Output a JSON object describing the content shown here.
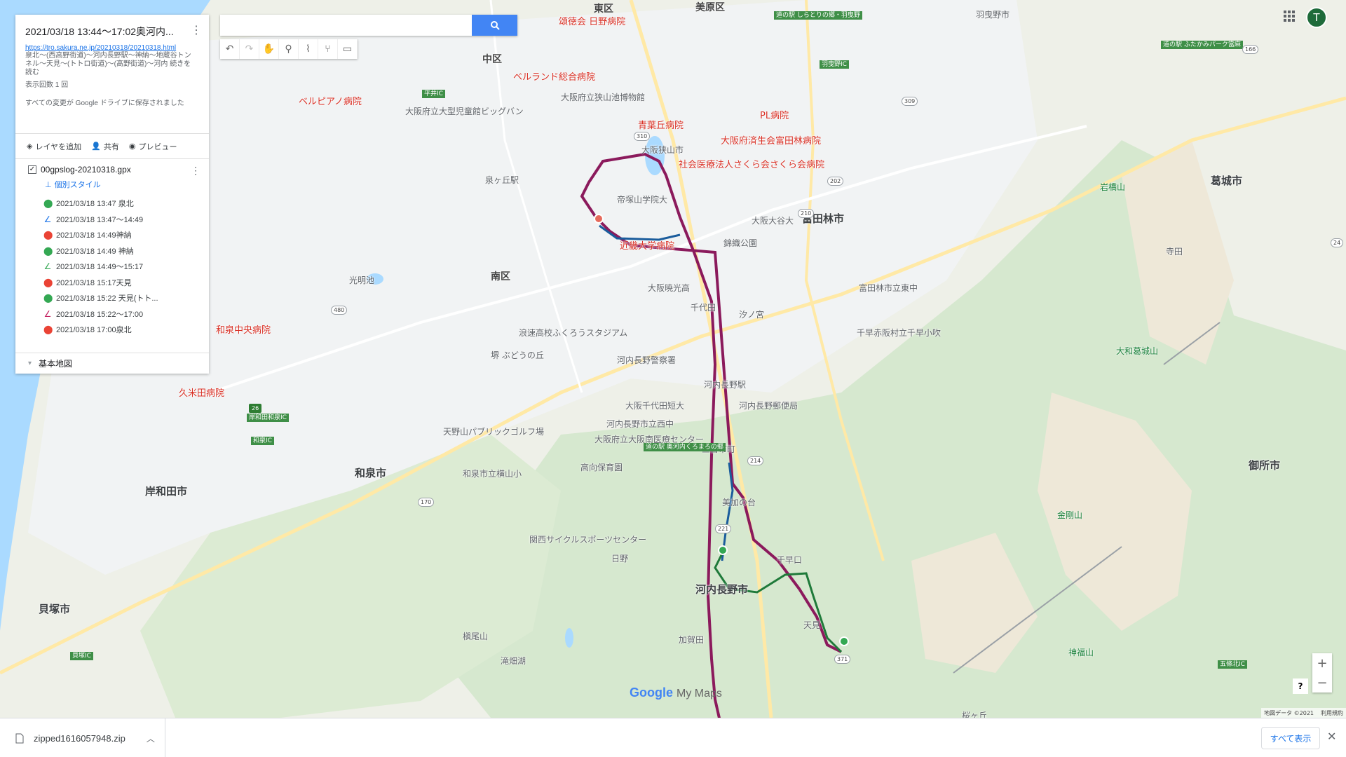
{
  "search": {
    "placeholder": "",
    "button_icon": "search-icon"
  },
  "toolbar": {
    "tools": [
      "undo-icon",
      "redo-icon",
      "hand-icon",
      "marker-icon",
      "draw-line-icon",
      "directions-icon",
      "ruler-icon"
    ]
  },
  "panel": {
    "title": "2021/03/18 13:44～17:02奥河内...",
    "link": "https://tro.sakura.ne.jp/20210318/20210318.html",
    "description": "泉北～(西高野街道)～河内長野駅～神納～地蔵谷トンネル～天見～(トトロ街道)～(高野街道)～河内 続きを読む",
    "views": "表示回数 1 回",
    "save_status": "すべての変更が Google ドライブに保存されました",
    "actions": {
      "add_layer": "レイヤを追加",
      "share": "共有",
      "preview": "プレビュー"
    },
    "layer": {
      "name": "00gpslog-20210318.gpx",
      "style_label": "個別スタイル",
      "features": [
        {
          "label": "2021/03/18 13:47 泉北",
          "icon": "pin-icon",
          "color": "#34a853"
        },
        {
          "label": "2021/03/18 13:47～14:49",
          "icon": "line-icon",
          "color": "#1a73e8"
        },
        {
          "label": "2021/03/18 14:49神納",
          "icon": "pin-icon",
          "color": "#ea4335"
        },
        {
          "label": "2021/03/18 14:49 神納",
          "icon": "pin-icon",
          "color": "#34a853"
        },
        {
          "label": "2021/03/18 14:49～15:17",
          "icon": "line-icon",
          "color": "#34a853"
        },
        {
          "label": "2021/03/18 15:17天見",
          "icon": "pin-icon",
          "color": "#ea4335"
        },
        {
          "label": "2021/03/18 15:22 天見(トト...",
          "icon": "pin-icon",
          "color": "#34a853"
        },
        {
          "label": "2021/03/18 15:22～17:00",
          "icon": "line-icon",
          "color": "#c2185b"
        },
        {
          "label": "2021/03/18 17:00泉北",
          "icon": "pin-icon",
          "color": "#ea4335"
        }
      ]
    },
    "basemap": "基本地図"
  },
  "map": {
    "cities": [
      "富田林市",
      "河内長野市",
      "和泉市",
      "岸和田市",
      "葛城市",
      "御所市",
      "貝塚市",
      "南区",
      "中区",
      "東区",
      "美原区"
    ],
    "pois_red": [
      "ベルランド総合病院",
      "ベルピアノ病院",
      "青葉丘病院",
      "PL病院",
      "大阪府済生会富田林病院",
      "社会医療法人さくら会さくら会病院",
      "近畿大学病院",
      "久米田病院",
      "頌徳会 日野病院",
      "和泉中央病院"
    ],
    "pois_gray": [
      "大阪府立大型児童館ビッグバン",
      "泉ヶ丘駅",
      "大阪狭山市",
      "帝塚山学院大",
      "大阪大谷大",
      "錦織公園",
      "大阪暁光高",
      "汐ノ宮",
      "千代田",
      "河内長野駅",
      "大阪千代田短大",
      "河内長野市立西中",
      "三日市町",
      "美加の台",
      "千早口",
      "天見",
      "河内長野警察署",
      "大阪府立大阪南医療センター",
      "河内長野郵便局",
      "天野山パブリックゴルフ場",
      "和泉市立横山小",
      "関西サイクルスポーツセンター",
      "光明池",
      "槇尾山",
      "滝畑湖",
      "大阪府立狭山池博物館",
      "金剛山",
      "大和葛城山",
      "神福山",
      "岩橋山",
      "堺 ぶどうの丘",
      "浪速高校ふくろうスタジアム",
      "高向保育園",
      "日野",
      "加賀田",
      "千早赤阪村立千早小吹",
      "富田林市立東中",
      "寺田",
      "桜ヶ丘",
      "羽曳野市"
    ],
    "roads": [
      "310",
      "170",
      "210",
      "221",
      "371",
      "26",
      "480",
      "24",
      "309",
      "166",
      "202",
      "214"
    ],
    "green_labels": [
      "道の駅 しらとりの郷・羽曳野",
      "道の駅 奥河内くろまろの郷",
      "道の駅 ふたかみパーク當麻",
      "和泉IC",
      "岸和田和泉IC",
      "貝塚IC",
      "五條北IC",
      "平井IC",
      "羽曳野IC"
    ]
  },
  "logo": {
    "google": "Google",
    "my_maps": "My Maps"
  },
  "attribution": {
    "data": "地図データ ©2021",
    "terms": "利用規約"
  },
  "user": {
    "avatar_letter": "T"
  },
  "zoom": {
    "in": "+",
    "out": "−"
  },
  "help": "?",
  "download_bar": {
    "filename": "zipped1616057948.zip",
    "show_all": "すべて表示",
    "close": "✕"
  },
  "colors": {
    "route_blue": "#1a5c9c",
    "route_green": "#1f7a3a",
    "route_purple": "#8b1a5c",
    "accent": "#4285f4"
  }
}
